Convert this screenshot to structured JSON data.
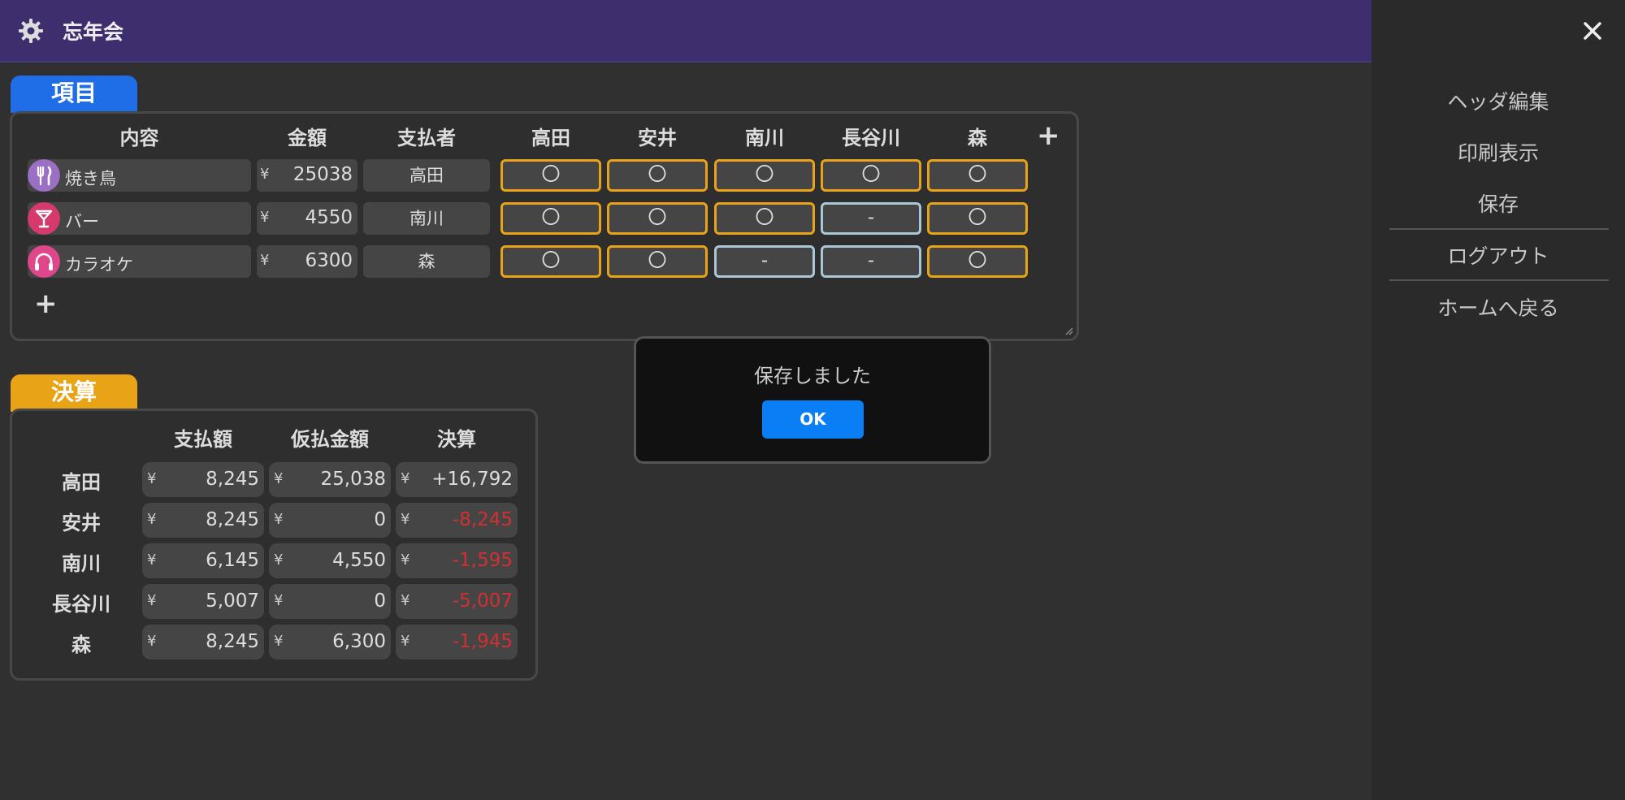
{
  "app": {
    "title": "忘年会"
  },
  "sidebar": {
    "items": [
      "ヘッダ編集",
      "印刷表示",
      "保存",
      "ログアウト",
      "ホームへ戻る"
    ]
  },
  "items_section": {
    "tab_label": "項目",
    "headers": {
      "content": "内容",
      "amount": "金額",
      "payer": "支払者"
    },
    "members": [
      "高田",
      "安井",
      "南川",
      "長谷川",
      "森"
    ],
    "add_member": "+",
    "add_item": "+",
    "rows": [
      {
        "icon": "fork-knife-icon",
        "icon_color": "#9a6fc4",
        "name": "焼き鳥",
        "yen": "¥",
        "amount": "25038",
        "payer": "高田",
        "participation": [
          "〇",
          "〇",
          "〇",
          "〇",
          "〇"
        ]
      },
      {
        "icon": "cocktail-icon",
        "icon_color": "#d63a6c",
        "name": "バー",
        "yen": "¥",
        "amount": "4550",
        "payer": "南川",
        "participation": [
          "〇",
          "〇",
          "〇",
          "-",
          "〇"
        ]
      },
      {
        "icon": "headphones-icon",
        "icon_color": "#e0468a",
        "name": "カラオケ",
        "yen": "¥",
        "amount": "6300",
        "payer": "森",
        "participation": [
          "〇",
          "〇",
          "-",
          "-",
          "〇"
        ]
      }
    ]
  },
  "settlement": {
    "tab_label": "決算",
    "headers": {
      "pay": "支払額",
      "advance": "仮払金額",
      "result": "決算"
    },
    "rows": [
      {
        "name": "高田",
        "pay": "8,245",
        "advance": "25,038",
        "result": "+16,792",
        "negative": false
      },
      {
        "name": "安井",
        "pay": "8,245",
        "advance": "0",
        "result": "-8,245",
        "negative": true
      },
      {
        "name": "南川",
        "pay": "6,145",
        "advance": "4,550",
        "result": "-1,595",
        "negative": true
      },
      {
        "name": "長谷川",
        "pay": "5,007",
        "advance": "0",
        "result": "-5,007",
        "negative": true
      },
      {
        "name": "森",
        "pay": "8,245",
        "advance": "6,300",
        "result": "-1,945",
        "negative": true
      }
    ]
  },
  "dialog": {
    "message": "保存しました",
    "ok_label": "OK"
  },
  "colors": {
    "header": "#3f2e6d",
    "accent_blue": "#1f6ee8",
    "accent_orange": "#e8a317",
    "on_border": "#e8a317",
    "off_border": "#a9c7d6",
    "negative": "#d23030",
    "ok_button": "#0a7ff5"
  }
}
